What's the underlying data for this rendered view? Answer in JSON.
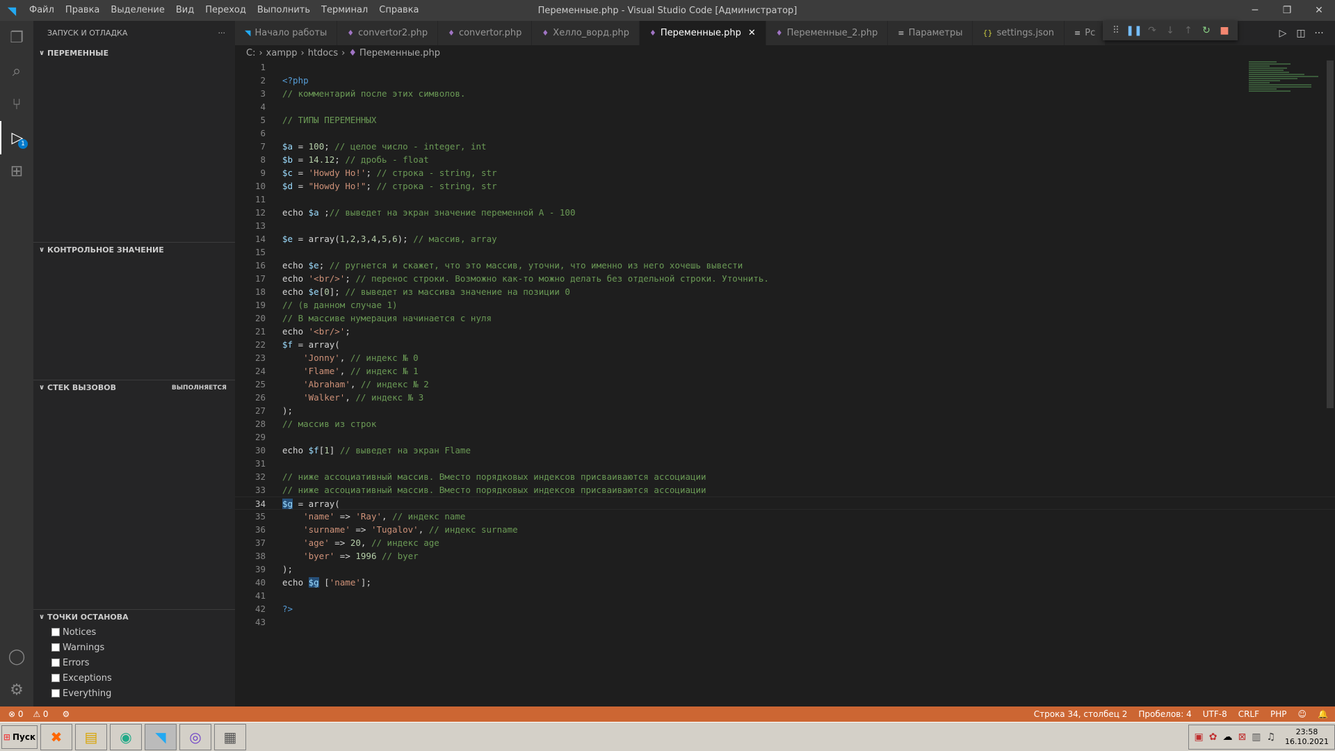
{
  "titlebar": {
    "menu": [
      "Файл",
      "Правка",
      "Выделение",
      "Вид",
      "Переход",
      "Выполнить",
      "Терминал",
      "Справка"
    ],
    "title": "Переменные.php - Visual Studio Code [Администратор]"
  },
  "sidebar": {
    "header": "ЗАПУСК И ОТЛАДКА",
    "more": "···",
    "sections": {
      "variables": "ПЕРЕМЕННЫЕ",
      "watch": "КОНТРОЛЬНОЕ ЗНАЧЕНИЕ",
      "callstack": "СТЕК ВЫЗОВОВ",
      "callstack_status": "ВЫПОЛНЯЕТСЯ",
      "breakpoints": "ТОЧКИ ОСТАНОВА"
    },
    "breakpoints": [
      "Notices",
      "Warnings",
      "Errors",
      "Exceptions",
      "Everything"
    ]
  },
  "activity": {
    "debug_badge": "1"
  },
  "tabs": [
    {
      "label": "Начало работы",
      "icon": "vscode-icon"
    },
    {
      "label": "convertor2.php",
      "icon": "php-icon"
    },
    {
      "label": "convertor.php",
      "icon": "php-icon"
    },
    {
      "label": "Хелло_ворд.php",
      "icon": "php-icon"
    },
    {
      "label": "Переменные.php",
      "icon": "php-icon",
      "active": true
    },
    {
      "label": "Переменные_2.php",
      "icon": "php-icon"
    },
    {
      "label": "Параметры",
      "icon": "settings-icon"
    },
    {
      "label": "settings.json",
      "icon": "json-icon"
    },
    {
      "label": "Pc",
      "icon": "file-icon"
    }
  ],
  "breadcrumb": [
    "C:",
    "xampp",
    "htdocs",
    "Переменные.php"
  ],
  "status": {
    "errors": "0",
    "warnings": "0",
    "position": "Строка 34, столбец 2",
    "spaces": "Пробелов: 4",
    "encoding": "UTF-8",
    "eol": "CRLF",
    "language": "PHP"
  },
  "taskbar": {
    "start": "Пуск",
    "time": "23:58",
    "date": "16.10.2021"
  }
}
